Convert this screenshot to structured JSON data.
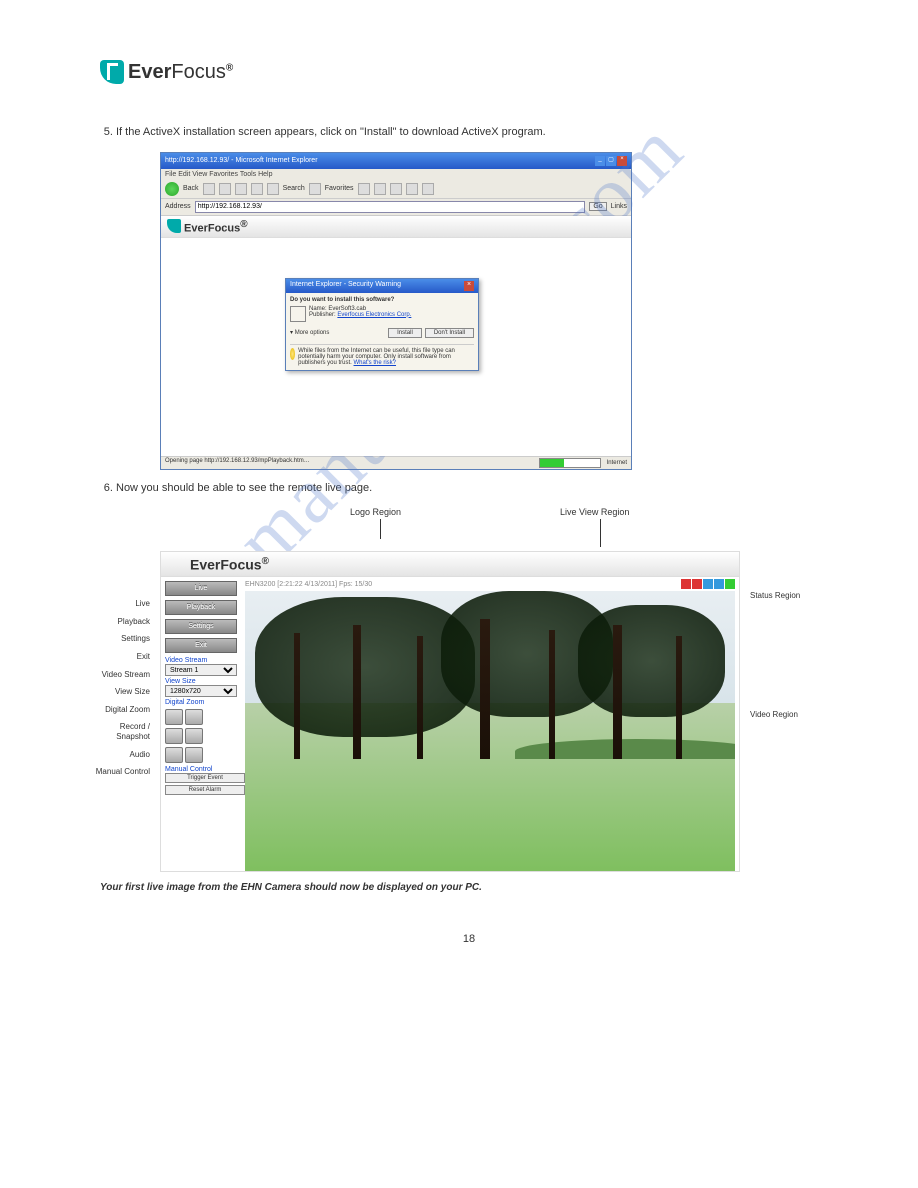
{
  "brand": {
    "name_bold": "Ever",
    "name_light": "Focus",
    "reg": "®"
  },
  "steps": {
    "s5": "If the ActiveX installation screen appears, click on \"Install\" to download ActiveX program.",
    "s6": "Now you should be able to see the remote live page."
  },
  "ie": {
    "title": "http://192.168.12.93/ - Microsoft Internet Explorer",
    "menu": "File   Edit   View   Favorites   Tools   Help",
    "back": "Back",
    "search": "Search",
    "favorites": "Favorites",
    "addr_label": "Address",
    "addr": "http://192.168.12.93/",
    "go": "Go",
    "links": "Links",
    "status": "Opening page http://192.168.12.93/mpPlayback.htm…",
    "internet": "Internet"
  },
  "dialog": {
    "title": "Internet Explorer - Security Warning",
    "question": "Do you want to install this software?",
    "name_label": "Name:",
    "name": "EverSoft3.cab",
    "pub_label": "Publisher:",
    "pub": "Everfocus Electronics Corp.",
    "more": "More options",
    "install": "Install",
    "dont": "Don't Install",
    "warn": "While files from the Internet can be useful, this file type can potentially harm your computer. Only install software from publishers you trust.",
    "risk": "What's the risk?"
  },
  "live": {
    "info": "EHN3200 [2:21:22 4/13/2011] Fps: 15/30",
    "nav": {
      "live": "Live",
      "playback": "Playback",
      "settings": "Settings",
      "exit": "Exit"
    },
    "video_stream": {
      "label": "Video Stream",
      "value": "Stream 1"
    },
    "view_size": {
      "label": "View Size",
      "value": "1280x720"
    },
    "digital_zoom": "Digital Zoom",
    "manual": {
      "label": "Manual Control",
      "trigger": "Trigger Event",
      "reset": "Reset Alarm"
    }
  },
  "labels": {
    "logo_region": "Logo Region",
    "live_view_region": "Live View Region",
    "live": "Live",
    "playback": "Playback",
    "settings": "Settings",
    "exit": "Exit",
    "vs": "Video Stream",
    "viewsize": "View Size",
    "dz": "Digital Zoom",
    "rec_snap": "Record / Snapshot",
    "audio": "Audio",
    "manual": "Manual Control",
    "status": "Status Region",
    "video": "Video Region"
  },
  "footnote": "Your first live image from the EHN Camera should now be displayed on your PC.",
  "page": "18",
  "watermark": "manualshive.com"
}
